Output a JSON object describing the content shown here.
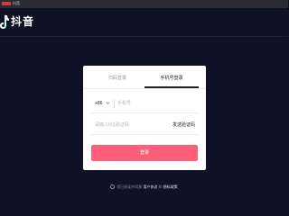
{
  "browser": {
    "tab_label": "抖音"
  },
  "header": {
    "logo_text": "抖音"
  },
  "login": {
    "tabs": [
      {
        "label": "扫码登录",
        "active": false
      },
      {
        "label": "手机号登录",
        "active": true
      }
    ],
    "country_code": "+86",
    "phone_placeholder": "手机号",
    "code_placeholder": "请输入6位验证码",
    "send_code_label": "发送验证码",
    "login_button_label": "登录"
  },
  "agreement": {
    "prefix": "我已阅读并同意",
    "user_agreement": "用户协议",
    "and": "和",
    "privacy_policy": "隐私政策"
  },
  "colors": {
    "background": "#0f1124",
    "accent": "#fe5e78",
    "card": "#ffffff"
  }
}
